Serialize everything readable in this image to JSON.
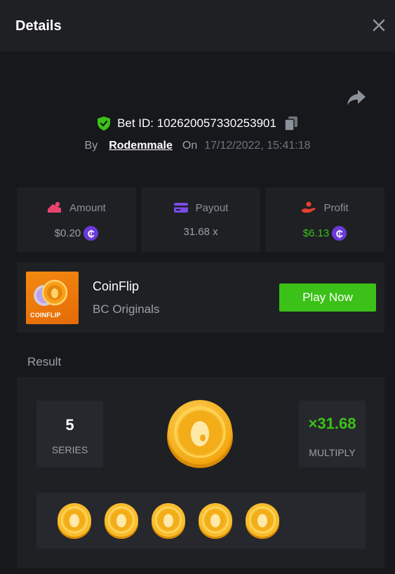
{
  "header": {
    "title": "Details"
  },
  "bet": {
    "id_label": "Bet ID: 102620057330253901",
    "by_label": "By",
    "user": "Rodemmale",
    "on_label": "On",
    "date": "17/12/2022, 15:41:18"
  },
  "stats": [
    {
      "label": "Amount",
      "value": "$0.20",
      "icon": "amount-icon",
      "color": "#e9436d"
    },
    {
      "label": "Payout",
      "value": "31.68 x",
      "icon": "payout-card-icon",
      "color": "#7b4be8"
    },
    {
      "label": "Profit",
      "value": "$6.13",
      "icon": "profit-hand-icon",
      "color": "#e8402f"
    }
  ],
  "currency_symbol": "₵",
  "game": {
    "thumb_label": "COINFLIP",
    "name": "CoinFlip",
    "provider": "BC Originals",
    "play_label": "Play Now"
  },
  "result": {
    "title": "Result",
    "series_value": "5",
    "series_label": "SERIES",
    "multiply_value": "×31.68",
    "multiply_label": "MULTIPLY",
    "coin_count": 5
  },
  "colors": {
    "accent_green": "#3bc117",
    "currency_purple": "#6b3ad8",
    "panel": "#1e2024",
    "background": "#17181b"
  }
}
